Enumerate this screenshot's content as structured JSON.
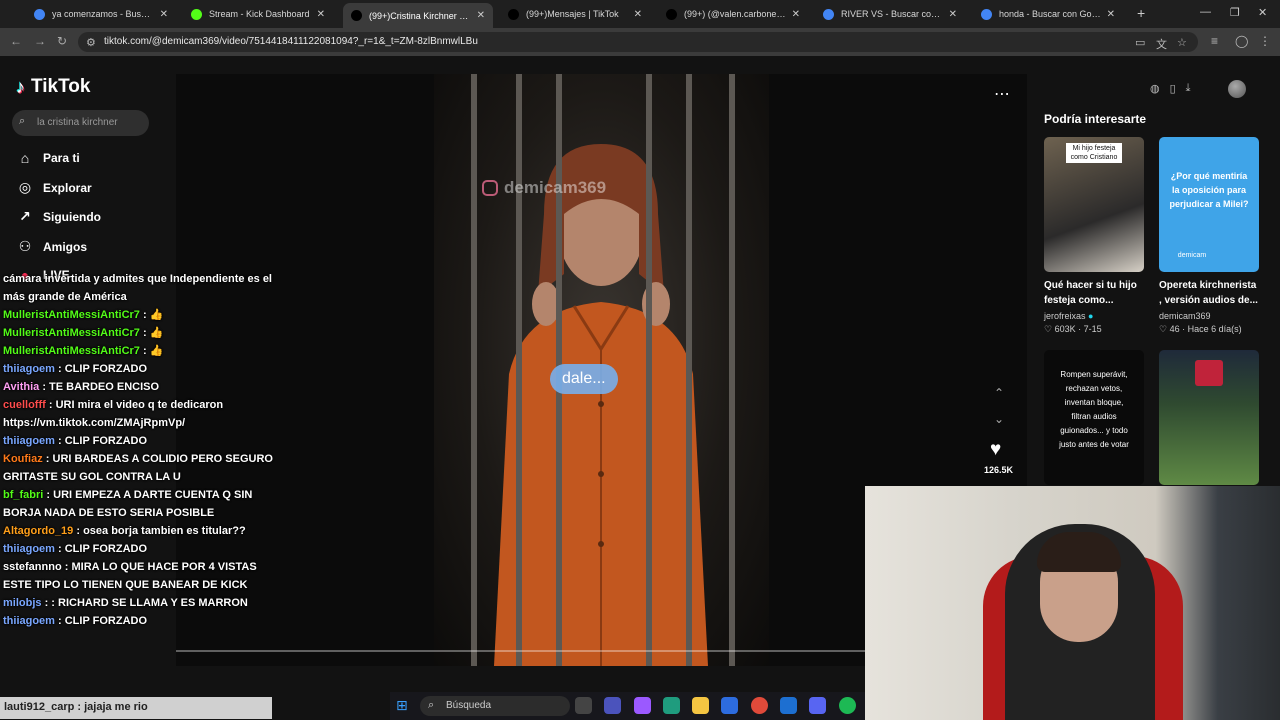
{
  "browser": {
    "tabs": [
      {
        "title": "ya comenzamos - Buscar con G",
        "favicon_color": "#4285f4",
        "active": false
      },
      {
        "title": "Stream - Kick Dashboard",
        "favicon_color": "#53fc18",
        "active": false
      },
      {
        "title": "(99+)Cristina Kirchner Con",
        "favicon_color": "#000000",
        "active": true
      },
      {
        "title": "(99+)Mensajes | TikTok",
        "favicon_color": "#000000",
        "active": false
      },
      {
        "title": "(99+) (@valen.carbone) | TikTok",
        "favicon_color": "#000000",
        "active": false
      },
      {
        "title": "RIVER VS - Buscar con Google",
        "favicon_color": "#4285f4",
        "active": false
      },
      {
        "title": "honda - Buscar con Google",
        "favicon_color": "#4285f4",
        "active": false
      }
    ],
    "url": "tiktok.com/@demicam369/video/7514418411122081094?_r=1&_t=ZM-8zlBnmwlLBu"
  },
  "sidebar": {
    "brand": "TikTok",
    "search_placeholder": "la cristina kirchner",
    "items": [
      {
        "label": "Para ti",
        "icon": "home-icon"
      },
      {
        "label": "Explorar",
        "icon": "compass-icon"
      },
      {
        "label": "Siguiendo",
        "icon": "following-icon"
      },
      {
        "label": "Amigos",
        "icon": "friends-icon"
      },
      {
        "label": "LIVE",
        "icon": "live-icon"
      }
    ]
  },
  "video": {
    "watermark": "demicam369",
    "caption": "dale...",
    "likes": "126.5K"
  },
  "suggestions": {
    "title": "Podría interesarte",
    "cards": [
      {
        "thumb_text": "Mi hijo festeja como Cristiano",
        "title": "Qué hacer si tu hijo festeja como...",
        "user": "jerofreixas",
        "stats": "603K · 7-15"
      },
      {
        "thumb_text": "¿Por qué mentiría la oposición para perjudicar a Milei?",
        "thumb_footer": "demicam",
        "title": "Opereta kirchnerista , versión audios de...",
        "user": "demicam369",
        "stats": "46 · Hace 6 día(s)"
      },
      {
        "thumb_text": "Rompen superávit, rechazan vetos, inventan bloque, filtran audios guionados... y todo justo antes de votar"
      },
      {
        "thumb_text": ""
      }
    ]
  },
  "chat": {
    "messages": [
      {
        "user": "",
        "text": "cámara invertida y admites que Independiente es el más grande de América",
        "color": "#ffffff"
      },
      {
        "user": "MulleristAntiMessiAntiCr7",
        "text": ": 👍",
        "color": "#53fc18"
      },
      {
        "user": "MulleristAntiMessiAntiCr7",
        "text": ": 👍",
        "color": "#53fc18"
      },
      {
        "user": "MulleristAntiMessiAntiCr7",
        "text": ": 👍",
        "color": "#53fc18"
      },
      {
        "user": "thiiagoem",
        "text": ": CLIP FORZADO",
        "color": "#7aa7ff"
      },
      {
        "user": "Avithia",
        "text": ": TE BARDEO ENCISO",
        "color": "#ff9ff3"
      },
      {
        "user": "cuellofff",
        "text": ": URI mira el video q te dedicaron https://vm.tiktok.com/ZMAjRpmVp/",
        "color": "#ff4d4d"
      },
      {
        "user": "thiiagoem",
        "text": ": CLIP FORZADO",
        "color": "#7aa7ff"
      },
      {
        "user": "Koufiaz",
        "text": ": URI BARDEAS A COLIDIO PERO SEGURO GRITASTE SU GOL CONTRA LA U",
        "color": "#ff7a1a"
      },
      {
        "user": "bf_fabri",
        "text": ": URI EMPEZA A DARTE CUENTA Q SIN BORJA NADA DE ESTO SERIA POSIBLE",
        "color": "#53fc18"
      },
      {
        "user": "Altagordo_19",
        "text": ": osea borja tambien es titular??",
        "color": "#ff9f1a"
      },
      {
        "user": "thiiagoem",
        "text": ": CLIP FORZADO",
        "color": "#7aa7ff"
      },
      {
        "user": "sstefannno",
        "text": ": MIRA LO QUE HACE POR 4 VISTAS ESTE TIPO LO TIENEN QUE BANEAR DE KICK",
        "color": "#ffffff"
      },
      {
        "user": "milobjs",
        "text": ": : RICHARD SE LLAMA Y ES MARRON",
        "color": "#7aa7ff"
      },
      {
        "user": "thiiagoem",
        "text": ": CLIP FORZADO",
        "color": "#7aa7ff"
      }
    ],
    "input_text": "lauti912_carp : jajaja me rio"
  },
  "taskbar": {
    "search_label": "Búsqueda"
  },
  "colors": {
    "accent": "#fe2c55",
    "page_bg": "#121212"
  }
}
